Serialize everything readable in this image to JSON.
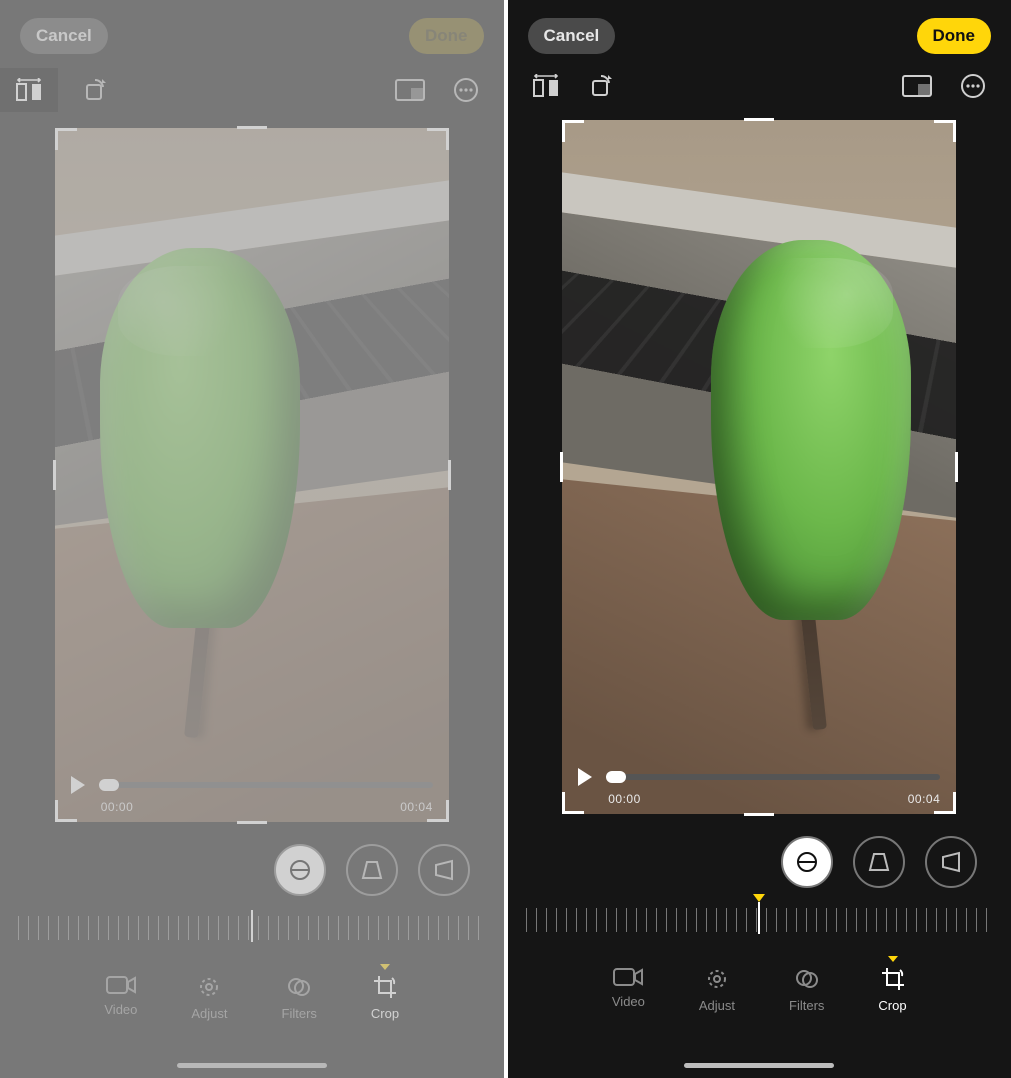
{
  "left": {
    "topbar": {
      "cancel": "Cancel",
      "done": "Done"
    },
    "playback": {
      "start": "00:00",
      "end": "00:04"
    },
    "tools": {
      "straighten": "straighten",
      "horizontal": "perspective-horizontal",
      "vertical": "perspective-vertical",
      "active": "straighten"
    },
    "tabs": {
      "items": [
        {
          "id": "video",
          "label": "Video"
        },
        {
          "id": "adjust",
          "label": "Adjust"
        },
        {
          "id": "filters",
          "label": "Filters"
        },
        {
          "id": "crop",
          "label": "Crop"
        }
      ],
      "active": "crop"
    },
    "subbar": {
      "flip": "flip-horizontal",
      "rotate": "rotate",
      "aspect": "aspect-ratio",
      "more": "more"
    }
  },
  "right": {
    "topbar": {
      "cancel": "Cancel",
      "done": "Done"
    },
    "playback": {
      "start": "00:00",
      "end": "00:04"
    },
    "tools": {
      "straighten": "straighten",
      "horizontal": "perspective-horizontal",
      "vertical": "perspective-vertical",
      "active": "straighten"
    },
    "tabs": {
      "items": [
        {
          "id": "video",
          "label": "Video"
        },
        {
          "id": "adjust",
          "label": "Adjust"
        },
        {
          "id": "filters",
          "label": "Filters"
        },
        {
          "id": "crop",
          "label": "Crop"
        }
      ],
      "active": "crop"
    },
    "subbar": {
      "flip": "flip-horizontal",
      "rotate": "rotate",
      "aspect": "aspect-ratio",
      "more": "more"
    }
  },
  "accent": "#ffd60a"
}
